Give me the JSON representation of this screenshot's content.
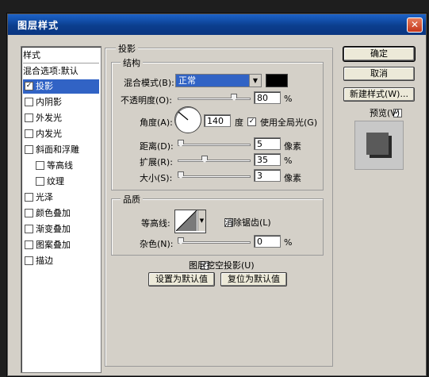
{
  "window": {
    "title": "图层样式",
    "close_glyph": "✕"
  },
  "styles_list": {
    "header": "样式",
    "blend_options": "混合选项:默认",
    "items": [
      {
        "label": "投影",
        "checked": true,
        "selected": true
      },
      {
        "label": "内阴影",
        "checked": false
      },
      {
        "label": "外发光",
        "checked": false
      },
      {
        "label": "内发光",
        "checked": false
      },
      {
        "label": "斜面和浮雕",
        "checked": false
      },
      {
        "label": "等高线",
        "checked": false
      },
      {
        "label": "纹理",
        "checked": false
      },
      {
        "label": "光泽",
        "checked": false
      },
      {
        "label": "颜色叠加",
        "checked": false
      },
      {
        "label": "渐变叠加",
        "checked": false
      },
      {
        "label": "图案叠加",
        "checked": false
      },
      {
        "label": "描边",
        "checked": false
      }
    ]
  },
  "panel": {
    "title": "投影",
    "structure": {
      "title": "结构",
      "blend_mode_label": "混合模式(B):",
      "blend_mode_value": "正常",
      "shadow_color": "#000000",
      "opacity_label": "不透明度(O):",
      "opacity_value": "80",
      "opacity_unit": "%",
      "opacity_level": 0.8,
      "angle_label": "角度(A):",
      "angle_value": "140",
      "angle_unit": "度",
      "global_light_label": "使用全局光(G)",
      "global_light_checked": true,
      "distance_label": "距离(D):",
      "distance_value": "5",
      "distance_unit": "像素",
      "spread_label": "扩展(R):",
      "spread_value": "35",
      "spread_unit": "%",
      "size_label": "大小(S):",
      "size_value": "3",
      "size_unit": "像素"
    },
    "quality": {
      "title": "品质",
      "contour_label": "等高线:",
      "antialias_label": "消除锯齿(L)",
      "antialias_checked": false,
      "noise_label": "杂色(N):",
      "noise_value": "0",
      "noise_unit": "%"
    },
    "knockout_label": "图层挖空投影(U)",
    "knockout_checked": true,
    "make_default_button": "设置为默认值",
    "reset_default_button": "复位为默认值"
  },
  "actions": {
    "ok": "确定",
    "cancel": "取消",
    "new_style": "新建样式(W)...",
    "preview_label": "预览(V)",
    "preview_checked": true
  }
}
